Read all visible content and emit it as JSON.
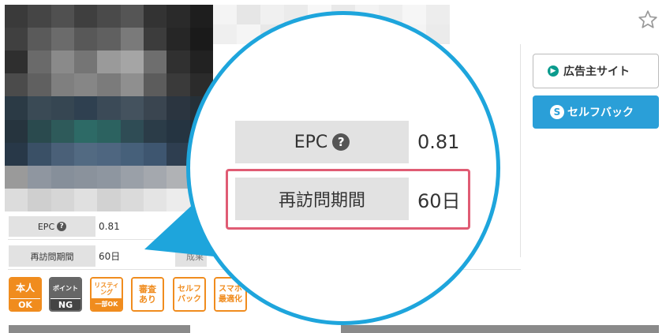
{
  "header": {
    "favorite_icon": "star-outline-icon"
  },
  "sidebar": {
    "advertiser_site_label": "広告主サイト",
    "advertiser_site_icon": "arrow-circle-icon",
    "self_back_label": "セルフバック",
    "self_back_icon": "s-circle-icon",
    "self_back_color": "#2a9fd8"
  },
  "info_table": {
    "rows": [
      {
        "label": "EPC",
        "value": "0.81",
        "has_help": true
      },
      {
        "label": "再訪問期間",
        "value": "60日",
        "has_help": false
      }
    ],
    "help_glyph": "?",
    "partial_label": "成果"
  },
  "badges": [
    {
      "top": "本人",
      "bottom": "OK",
      "color": "#f08c1e",
      "style": "filled-bottom"
    },
    {
      "top": "ポイント",
      "bottom": "NG",
      "color": "#666666",
      "style": "filled-bottom"
    },
    {
      "top": "リスティング",
      "bottom": "一部OK",
      "color": "#f08c1e",
      "style": "filled-bottom"
    },
    {
      "top": "審査あり",
      "bottom": "",
      "color": "#f08c1e",
      "style": "outline"
    },
    {
      "top": "セルフバック",
      "bottom": "",
      "color": "#f08c1e",
      "style": "outline"
    },
    {
      "top": "スマホ最適化",
      "bottom": "",
      "color": "#f08c1e",
      "style": "outline"
    }
  ],
  "magnifier": {
    "border_color": "#1ea5dc",
    "highlight_color": "#e05c74",
    "rows": [
      {
        "label": "EPC",
        "value": "0.81"
      },
      {
        "label": "再訪問期間",
        "value": "60日"
      }
    ]
  }
}
